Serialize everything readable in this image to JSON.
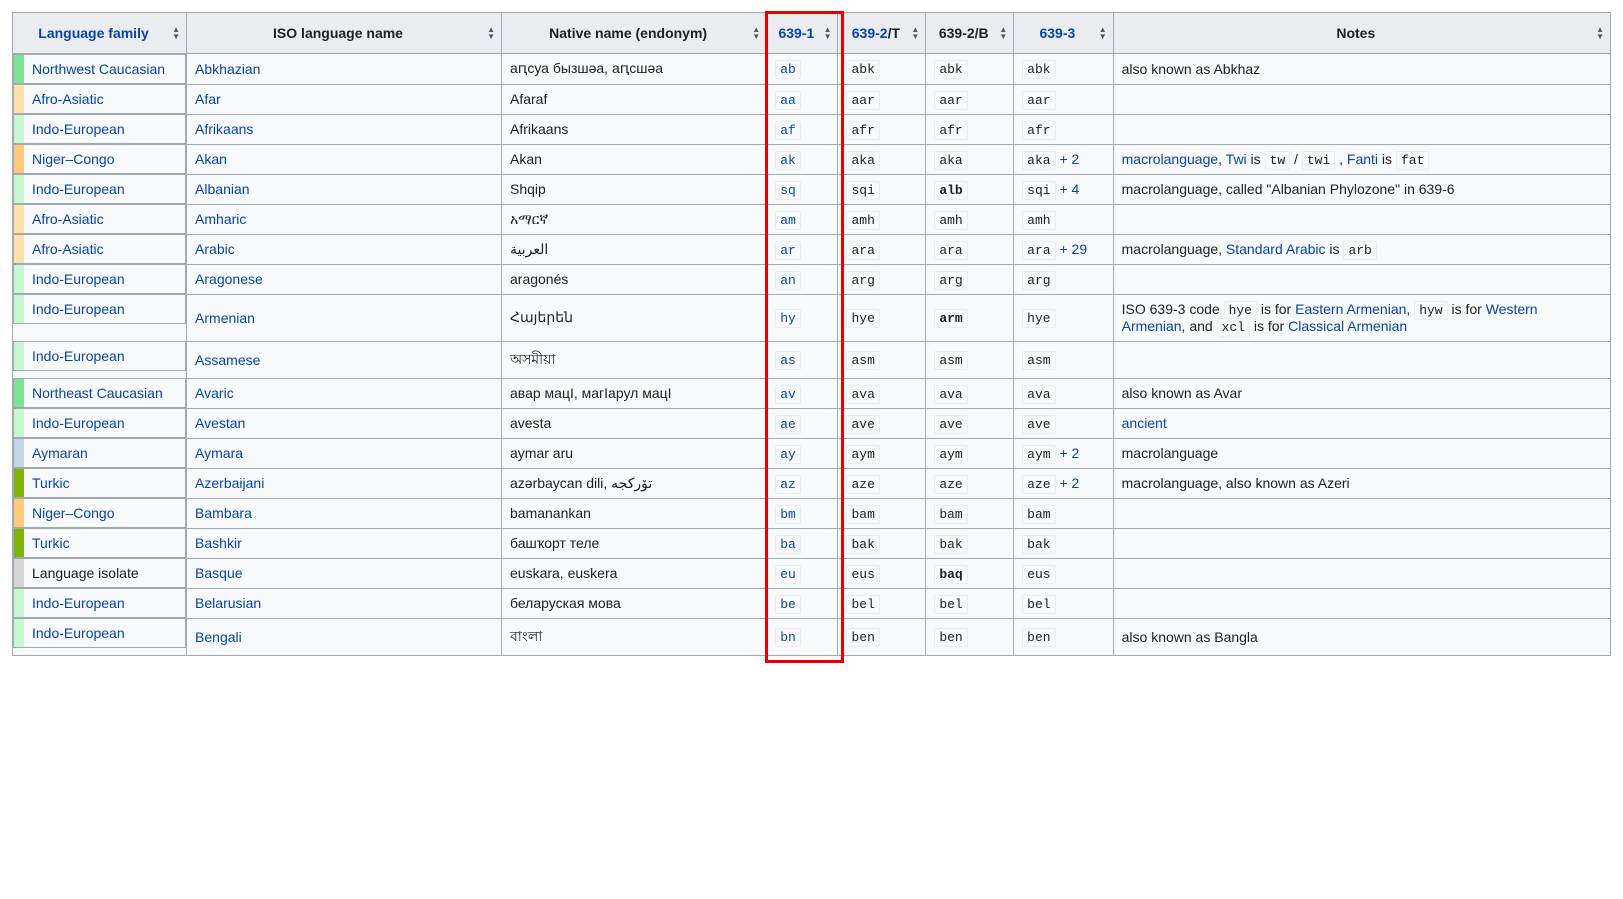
{
  "headers": {
    "family": "Language family",
    "name": "ISO language name",
    "native": "Native name (endonym)",
    "c6391": "639-1",
    "c6392t_pre": "639-2",
    "c6392t_suf": "/T",
    "c6392b": "639-2/B",
    "c6393": "639-3",
    "notes": "Notes"
  },
  "familyColors": {
    "Northwest Caucasian": "#7be495",
    "Afro-Asiatic": "#ffe0a6",
    "Indo-European": "#c6f7d0",
    "Niger–Congo": "#ffc97a",
    "Northeast Caucasian": "#7be495",
    "Aymaran": "#c3d6e8",
    "Turkic": "#7db500",
    "Language isolate": "#d6d6d6"
  },
  "rows": [
    {
      "family": "Northwest Caucasian",
      "familyLink": true,
      "name": "Abkhazian",
      "native": "аԥсуа бызшәа, аԥсшәа",
      "c1": "ab",
      "c2t": "abk",
      "c2b": "abk",
      "c2bBold": false,
      "c3": "abk",
      "c3extra": "",
      "notes": [
        {
          "t": "also known as Abkhaz"
        }
      ]
    },
    {
      "family": "Afro-Asiatic",
      "familyLink": true,
      "name": "Afar",
      "native": "Afaraf",
      "c1": "aa",
      "c2t": "aar",
      "c2b": "aar",
      "c2bBold": false,
      "c3": "aar",
      "c3extra": "",
      "notes": []
    },
    {
      "family": "Indo-European",
      "familyLink": true,
      "name": "Afrikaans",
      "native": "Afrikaans",
      "c1": "af",
      "c2t": "afr",
      "c2b": "afr",
      "c2bBold": false,
      "c3": "afr",
      "c3extra": "",
      "notes": []
    },
    {
      "family": "Niger–Congo",
      "familyLink": true,
      "name": "Akan",
      "native": "Akan",
      "c1": "ak",
      "c2t": "aka",
      "c2b": "aka",
      "c2bBold": false,
      "c3": "aka",
      "c3extra": " + 2",
      "notes": [
        {
          "t": "macrolanguage",
          "link": true
        },
        {
          "t": ", "
        },
        {
          "t": "Twi",
          "link": true
        },
        {
          "t": " is "
        },
        {
          "t": "tw",
          "code": true
        },
        {
          "t": " / "
        },
        {
          "t": "twi",
          "code": true
        },
        {
          "t": " , "
        },
        {
          "t": "Fanti",
          "link": true
        },
        {
          "t": " is "
        },
        {
          "t": "fat",
          "code": true
        }
      ]
    },
    {
      "family": "Indo-European",
      "familyLink": true,
      "name": "Albanian",
      "native": "Shqip",
      "c1": "sq",
      "c2t": "sqi",
      "c2b": "alb",
      "c2bBold": true,
      "c3": "sqi",
      "c3extra": " + 4",
      "notes": [
        {
          "t": "macrolanguage, called \"Albanian Phylozone\" in 639-6"
        }
      ]
    },
    {
      "family": "Afro-Asiatic",
      "familyLink": true,
      "name": "Amharic",
      "native": "አማርኛ",
      "c1": "am",
      "c2t": "amh",
      "c2b": "amh",
      "c2bBold": false,
      "c3": "amh",
      "c3extra": "",
      "notes": []
    },
    {
      "family": "Afro-Asiatic",
      "familyLink": true,
      "name": "Arabic",
      "native": "العربية",
      "c1": "ar",
      "c2t": "ara",
      "c2b": "ara",
      "c2bBold": false,
      "c3": "ara",
      "c3extra": " + 29",
      "notes": [
        {
          "t": "macrolanguage, "
        },
        {
          "t": "Standard Arabic",
          "link": true
        },
        {
          "t": " is "
        },
        {
          "t": "arb",
          "code": true
        }
      ]
    },
    {
      "family": "Indo-European",
      "familyLink": true,
      "name": "Aragonese",
      "native": "aragonés",
      "c1": "an",
      "c2t": "arg",
      "c2b": "arg",
      "c2bBold": false,
      "c3": "arg",
      "c3extra": "",
      "notes": []
    },
    {
      "family": "Indo-European",
      "familyLink": true,
      "name": "Armenian",
      "native": "Հայերեն",
      "c1": "hy",
      "c2t": "hye",
      "c2b": "arm",
      "c2bBold": true,
      "c3": "hye",
      "c3extra": "",
      "notes": [
        {
          "t": "ISO 639-3 code "
        },
        {
          "t": "hye",
          "code": true
        },
        {
          "t": " is for "
        },
        {
          "t": "Eastern Armenian",
          "link": true
        },
        {
          "t": ", "
        },
        {
          "t": "hyw",
          "code": true
        },
        {
          "t": " is for "
        },
        {
          "t": "Western Armenian",
          "link": true
        },
        {
          "t": ", and "
        },
        {
          "t": "xcl",
          "code": true
        },
        {
          "t": " is for "
        },
        {
          "t": "Classical Armenian",
          "link": true
        }
      ]
    },
    {
      "family": "Indo-European",
      "familyLink": true,
      "name": "Assamese",
      "native": "অসমীয়া",
      "c1": "as",
      "c2t": "asm",
      "c2b": "asm",
      "c2bBold": false,
      "c3": "asm",
      "c3extra": "",
      "notes": []
    },
    {
      "family": "Northeast Caucasian",
      "familyLink": true,
      "name": "Avaric",
      "native": "авар мацӀ, магӀарул мацӀ",
      "c1": "av",
      "c2t": "ava",
      "c2b": "ava",
      "c2bBold": false,
      "c3": "ava",
      "c3extra": "",
      "notes": [
        {
          "t": "also known as Avar"
        }
      ]
    },
    {
      "family": "Indo-European",
      "familyLink": true,
      "name": "Avestan",
      "native": "avesta",
      "c1": "ae",
      "c2t": "ave",
      "c2b": "ave",
      "c2bBold": false,
      "c3": "ave",
      "c3extra": "",
      "notes": [
        {
          "t": "ancient",
          "link": true
        }
      ]
    },
    {
      "family": "Aymaran",
      "familyLink": true,
      "name": "Aymara",
      "native": "aymar aru",
      "c1": "ay",
      "c2t": "aym",
      "c2b": "aym",
      "c2bBold": false,
      "c3": "aym",
      "c3extra": " + 2",
      "notes": [
        {
          "t": "macrolanguage"
        }
      ]
    },
    {
      "family": "Turkic",
      "familyLink": true,
      "name": "Azerbaijani",
      "native": "azərbaycan dili, تۆرکجه",
      "c1": "az",
      "c2t": "aze",
      "c2b": "aze",
      "c2bBold": false,
      "c3": "aze",
      "c3extra": " + 2",
      "notes": [
        {
          "t": "macrolanguage, also known as Azeri"
        }
      ]
    },
    {
      "family": "Niger–Congo",
      "familyLink": true,
      "name": "Bambara",
      "native": "bamanankan",
      "c1": "bm",
      "c2t": "bam",
      "c2b": "bam",
      "c2bBold": false,
      "c3": "bam",
      "c3extra": "",
      "notes": []
    },
    {
      "family": "Turkic",
      "familyLink": true,
      "name": "Bashkir",
      "native": "башҡорт теле",
      "c1": "ba",
      "c2t": "bak",
      "c2b": "bak",
      "c2bBold": false,
      "c3": "bak",
      "c3extra": "",
      "notes": []
    },
    {
      "family": "Language isolate",
      "familyLink": false,
      "name": "Basque",
      "native": "euskara, euskera",
      "c1": "eu",
      "c2t": "eus",
      "c2b": "baq",
      "c2bBold": true,
      "c3": "eus",
      "c3extra": "",
      "notes": []
    },
    {
      "family": "Indo-European",
      "familyLink": true,
      "name": "Belarusian",
      "native": "беларуская мова",
      "c1": "be",
      "c2t": "bel",
      "c2b": "bel",
      "c2bBold": false,
      "c3": "bel",
      "c3extra": "",
      "notes": []
    },
    {
      "family": "Indo-European",
      "familyLink": true,
      "name": "Bengali",
      "native": "বাংলা",
      "c1": "bn",
      "c2t": "ben",
      "c2b": "ben",
      "c2bBold": false,
      "c3": "ben",
      "c3extra": "",
      "notes": [
        {
          "t": "also known as Bangla"
        }
      ]
    }
  ]
}
